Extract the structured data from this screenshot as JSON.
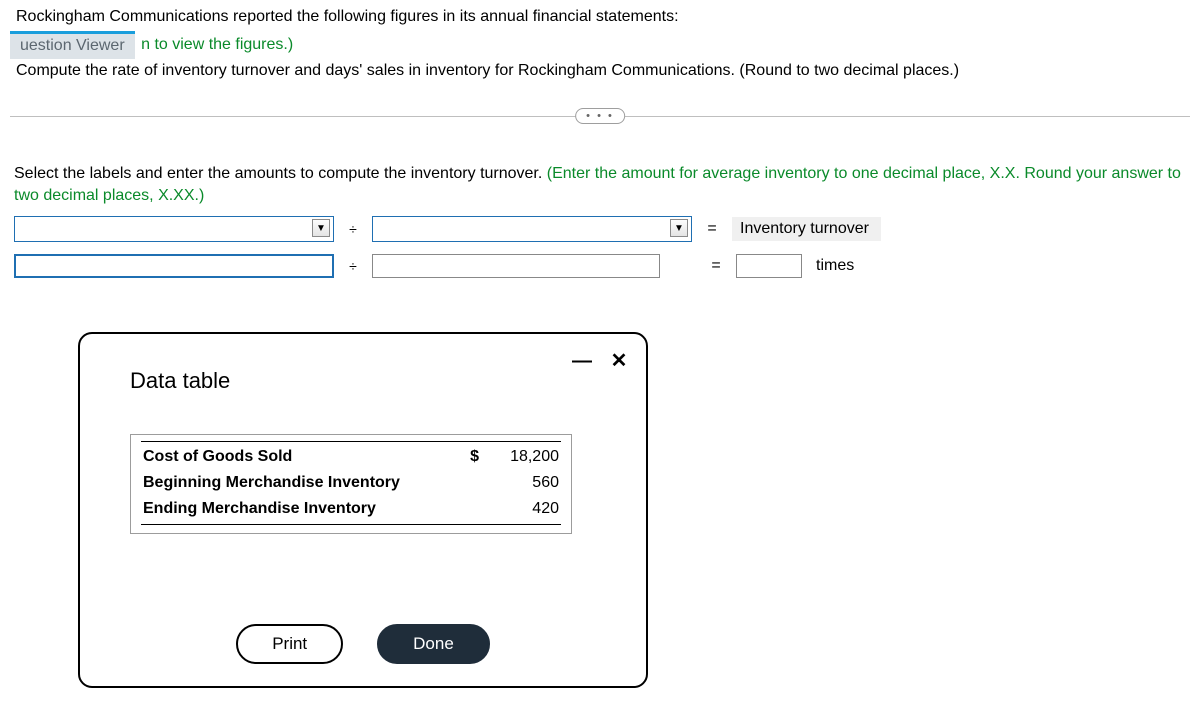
{
  "intro": {
    "line1": "Rockingham Communications reported the following figures in its annual financial statements:",
    "viewer_pill": "uestion Viewer",
    "link_fragment": "n to view the figures.)",
    "line3": "Compute the rate of inventory turnover and days' sales in inventory for Rockingham Communications. (Round to two decimal places.)"
  },
  "ellipsis": "• • •",
  "instruction": {
    "black": "Select the labels and enter the amounts to compute the inventory turnover. ",
    "green": "(Enter the amount for average inventory to one decimal place, X.X. Round your answer to two decimal places, X.XX.)"
  },
  "formula": {
    "divide": "÷",
    "equals": "=",
    "result_label": "Inventory turnover",
    "unit": "times"
  },
  "popup": {
    "title": "Data table",
    "currency": "$",
    "rows": [
      {
        "label": "Cost of Goods Sold",
        "show_currency": true,
        "value": "18,200"
      },
      {
        "label": "Beginning Merchandise Inventory",
        "show_currency": false,
        "value": "560"
      },
      {
        "label": "Ending Merchandise Inventory",
        "show_currency": false,
        "value": "420"
      }
    ],
    "print": "Print",
    "done": "Done"
  },
  "icons": {
    "minimize": "—",
    "close": "✕",
    "dropdown": "▼"
  }
}
